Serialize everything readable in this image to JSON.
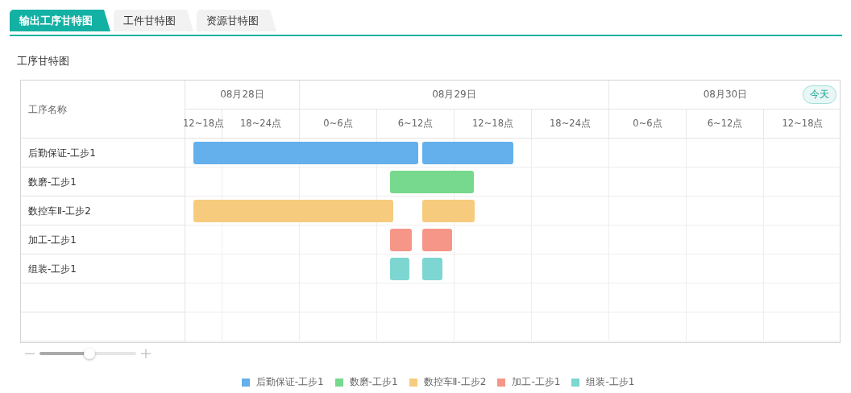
{
  "tabs": [
    {
      "label": "输出工序甘特图",
      "selected": true
    },
    {
      "label": "工件甘特图",
      "selected": false
    },
    {
      "label": "资源甘特图",
      "selected": false
    }
  ],
  "section_title": "工序甘特图",
  "gantt": {
    "name_header": "工序名称",
    "dates": [
      {
        "label": "08月28日",
        "slots": [
          "12~18点",
          "18~24点"
        ]
      },
      {
        "label": "08月29日",
        "slots": [
          "0~6点",
          "6~12点",
          "12~18点",
          "18~24点"
        ]
      },
      {
        "label": "08月30日",
        "badge": "今天",
        "slots": [
          "0~6点",
          "6~12点",
          "12~18点"
        ]
      }
    ],
    "rows": [
      {
        "name": "后勤保证-工步1",
        "color": "#63b0ec"
      },
      {
        "name": "数磨-工步1",
        "color": "#76d98d"
      },
      {
        "name": "数控车Ⅱ-工步2",
        "color": "#f7cb7e"
      },
      {
        "name": "加工-工步1",
        "color": "#f69688"
      },
      {
        "name": "组装-工步1",
        "color": "#7dd6d1"
      }
    ]
  },
  "zoom": {
    "level": 0.52
  },
  "legend": [
    {
      "label": "后勤保证-工步1",
      "color": "#63b0ec"
    },
    {
      "label": "数磨-工步1",
      "color": "#76d98d"
    },
    {
      "label": "数控车Ⅱ-工步2",
      "color": "#f7cb7e"
    },
    {
      "label": "加工-工步1",
      "color": "#f69688"
    },
    {
      "label": "组装-工步1",
      "color": "#7dd6d1"
    }
  ]
}
